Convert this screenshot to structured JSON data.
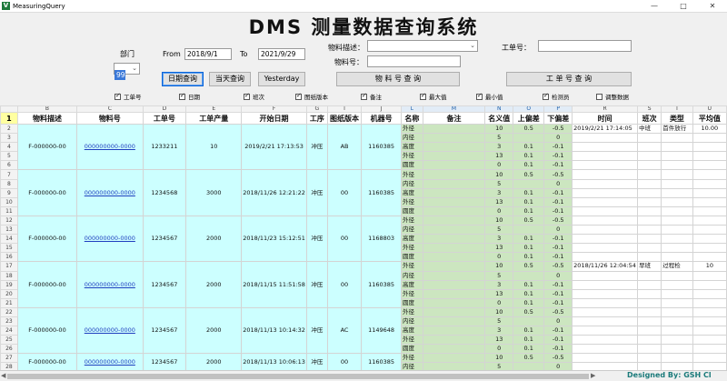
{
  "window": {
    "title": "MeasuringQuery",
    "icon_text": "V",
    "min": "—",
    "max": "□",
    "close": "✕"
  },
  "main_title": "DMS 测量数据查询系统",
  "filters": {
    "dept_label": "部门",
    "dept_value": "99",
    "from_label": "From",
    "from_value": "2018/9/1",
    "to_label": "To",
    "to_value": "2021/9/29",
    "material_desc_label": "物料描述：",
    "material_desc_value": "",
    "material_no_label": "物料号：",
    "material_no_value": "",
    "work_order_label": "工单号：",
    "work_order_value": ""
  },
  "buttons": {
    "date_query": "日期查询",
    "today_query": "当天查询",
    "yesterday": "Yesterday",
    "material_query": "物 料 号 查 询",
    "work_order_query": "工 单 号 查 询"
  },
  "checkboxes": [
    {
      "label": "工单号",
      "checked": true
    },
    {
      "label": "日期",
      "checked": true
    },
    {
      "label": "班次",
      "checked": true
    },
    {
      "label": "图纸版本",
      "checked": true
    },
    {
      "label": "备注",
      "checked": true
    },
    {
      "label": "最大值",
      "checked": true
    },
    {
      "label": "最小值",
      "checked": true
    },
    {
      "label": "检测员",
      "checked": true
    },
    {
      "label": "调整数据",
      "checked": false
    }
  ],
  "grid": {
    "column_letters": [
      "B",
      "C",
      "D",
      "E",
      "F",
      "G",
      "I",
      "J",
      "L",
      "M",
      "N",
      "O",
      "P",
      "R",
      "S",
      "T",
      "U"
    ],
    "headers": [
      "物料描述",
      "物料号",
      "工单号",
      "工单产量",
      "开始日期",
      "工序",
      "图纸版本",
      "机器号",
      "名称",
      "备注",
      "名义值",
      "上偏差",
      "下偏差",
      "时间",
      "班次",
      "类型",
      "平均值"
    ],
    "groups": [
      {
        "desc": "F-000000-00",
        "material": "000000000-0000",
        "order": "1233211",
        "qty": "10",
        "start": "2019/2/21 17:13:53",
        "process": "冲压",
        "version": "AB",
        "machine": "1160385"
      },
      {
        "desc": "F-000000-00",
        "material": "000000000-0000",
        "order": "1234568",
        "qty": "3000",
        "start": "2018/11/26 12:21:22",
        "process": "冲压",
        "version": "00",
        "machine": "1160385"
      },
      {
        "desc": "F-000000-00",
        "material": "000000000-0000",
        "order": "1234567",
        "qty": "2000",
        "start": "2018/11/23 15:12:51",
        "process": "冲压",
        "version": "00",
        "machine": "1168803"
      },
      {
        "desc": "F-000000-00",
        "material": "000000000-0000",
        "order": "1234567",
        "qty": "2000",
        "start": "2018/11/15 11:51:58",
        "process": "冲压",
        "version": "00",
        "machine": "1160385"
      },
      {
        "desc": "F-000000-00",
        "material": "000000000-0000",
        "order": "1234567",
        "qty": "2000",
        "start": "2018/11/13 10:14:32",
        "process": "冲压",
        "version": "AC",
        "machine": "1149648"
      },
      {
        "desc": "F-000000-00",
        "material": "000000000-0000",
        "order": "1234567",
        "qty": "2000",
        "start": "2018/11/13 10:06:13",
        "process": "冲压",
        "version": "00",
        "machine": "1160385"
      }
    ],
    "measure_template": [
      {
        "name": "外径",
        "nominal": "10",
        "upper": "0.5",
        "lower": "-0.5"
      },
      {
        "name": "内径",
        "nominal": "5",
        "upper": "",
        "lower": "0"
      },
      {
        "name": "高度",
        "nominal": "3",
        "upper": "0.1",
        "lower": "-0.1"
      },
      {
        "name": "外径",
        "nominal": "13",
        "upper": "0.1",
        "lower": "-0.1"
      },
      {
        "name": "圆度",
        "nominal": "0",
        "upper": "0.1",
        "lower": "-0.1"
      }
    ],
    "row_extras": {
      "2": {
        "time": "2019/2/21 17:14:05",
        "shift": "中班",
        "type": "首件放行",
        "avg": "10.00"
      },
      "17": {
        "time": "2018/11/26 12:04:54",
        "shift": "早班",
        "type": "过程检",
        "avg": "10"
      }
    },
    "total_rows": 28
  },
  "scrollbar": {
    "left_arrow": "◀",
    "right_arrow": "▶",
    "overlay_text": "Designed By: GSH Cl"
  }
}
